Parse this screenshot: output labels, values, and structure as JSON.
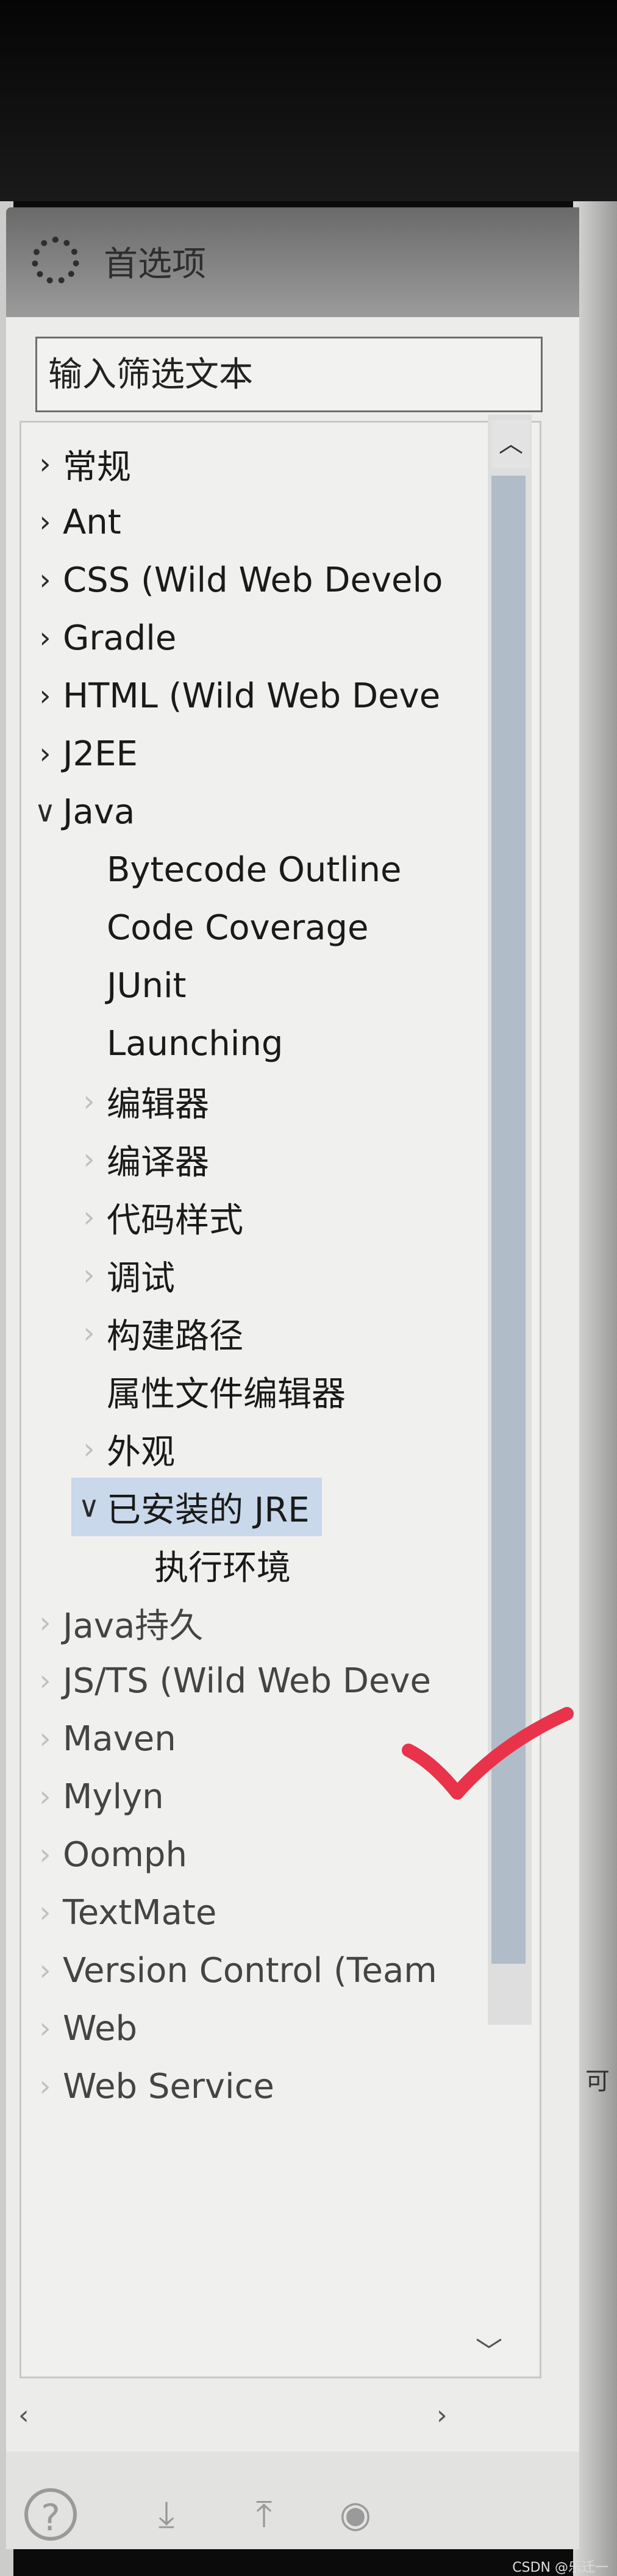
{
  "window": {
    "title": "首选项",
    "icon": "gear-icon"
  },
  "filter": {
    "placeholder": "输入筛选文本"
  },
  "tree": {
    "top_items": [
      "常规",
      "Ant",
      "CSS (Wild Web Develo",
      "Gradle",
      "HTML (Wild Web Deve",
      "J2EE"
    ],
    "java": {
      "label": "Java",
      "children": [
        "Bytecode Outline",
        "Code Coverage",
        "JUnit",
        "Launching",
        "编辑器",
        "编译器",
        "代码样式",
        "调试",
        "构建路径",
        "属性文件编辑器",
        "外观"
      ],
      "selected": "已安装的 JRE",
      "selected_child": "执行环境"
    },
    "bottom_items": [
      "Java持久",
      "JS/TS (Wild Web Deve",
      "Maven",
      "Mylyn",
      "Oomph",
      "TextMate",
      "Version Control (Team",
      "Web",
      "Web Service"
    ]
  },
  "annotation": {
    "color": "#e8334a",
    "icon": "checkmark-icon"
  },
  "right_fragment": "可",
  "watermark": "CSDN @乐迁一"
}
